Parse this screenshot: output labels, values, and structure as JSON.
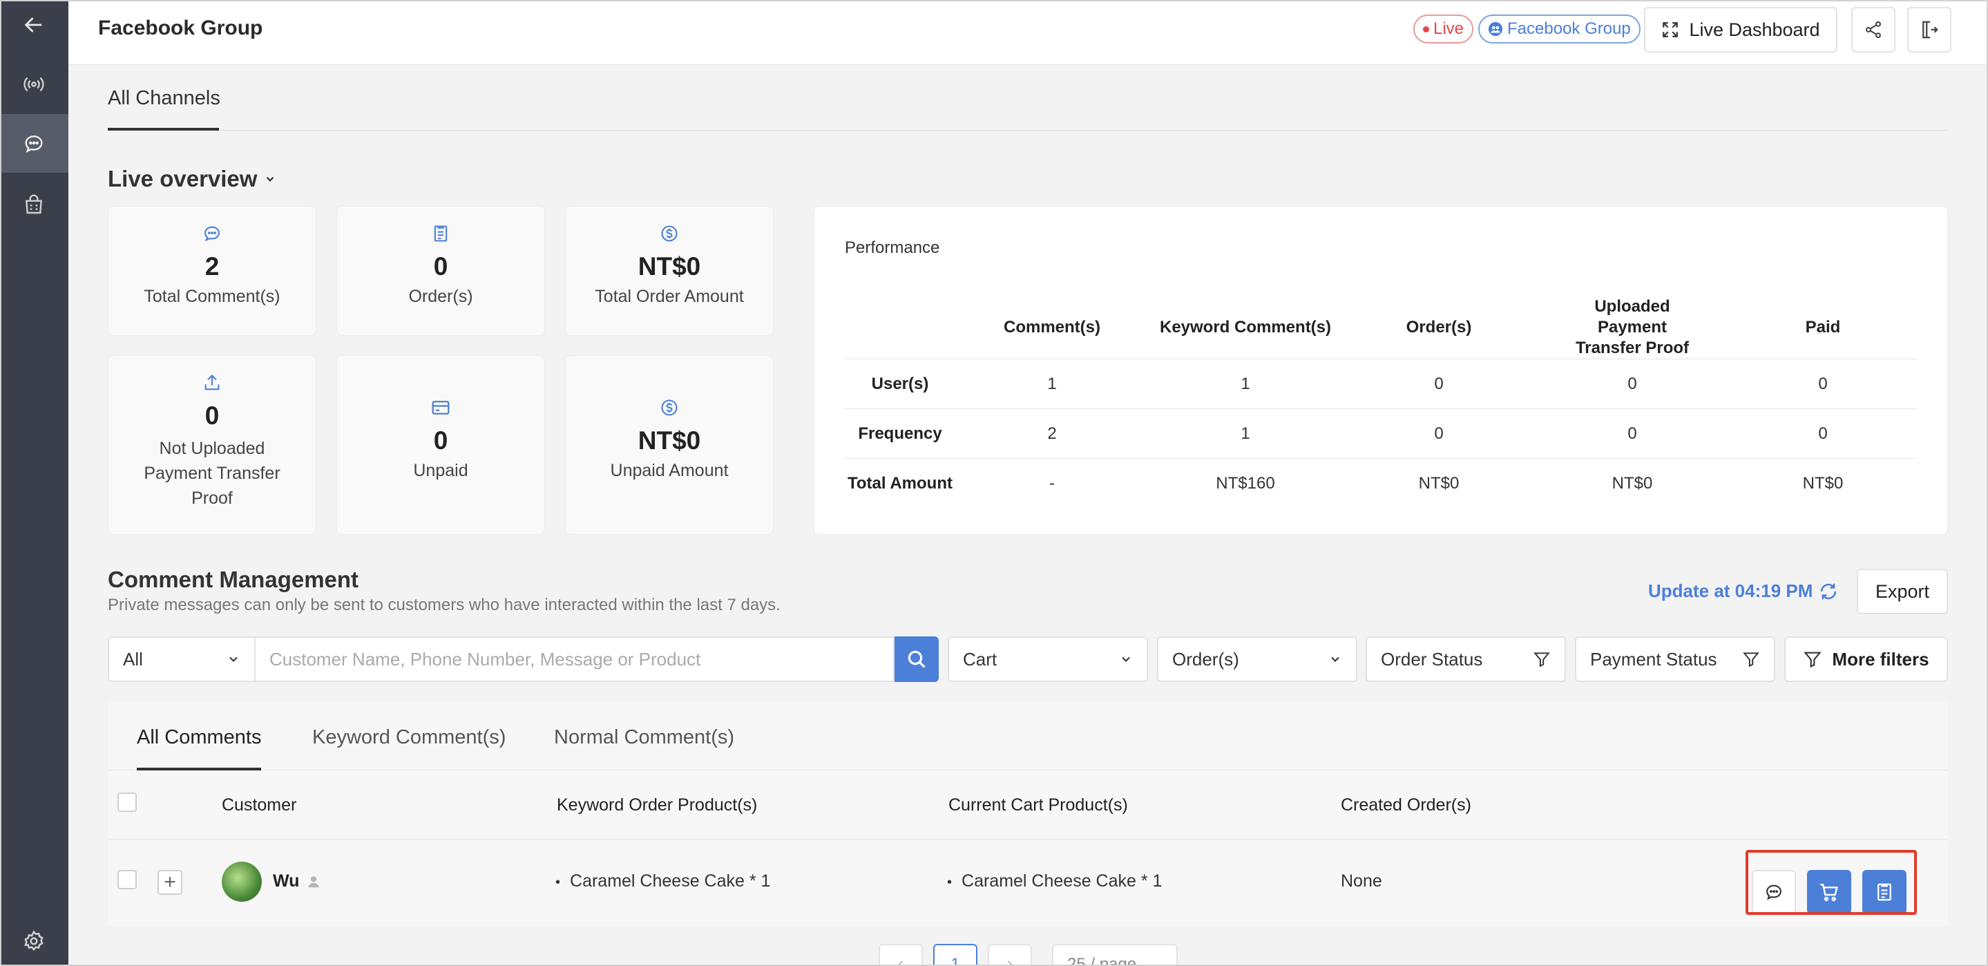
{
  "header": {
    "title": "Facebook Group",
    "live_label": "Live",
    "group_label": "Facebook Group",
    "dashboard_label": "Live Dashboard"
  },
  "tabs": {
    "all_channels": "All Channels"
  },
  "overview": {
    "title": "Live overview",
    "cards": [
      {
        "icon": "chat-icon",
        "value": "2",
        "label": "Total Comment(s)"
      },
      {
        "icon": "order-icon",
        "value": "0",
        "label": "Order(s)"
      },
      {
        "icon": "dollar-icon",
        "value": "NT$0",
        "label": "Total Order Amount"
      },
      {
        "icon": "upload-icon",
        "value": "0",
        "label": "Not Uploaded Payment Transfer Proof"
      },
      {
        "icon": "card-icon",
        "value": "0",
        "label": "Unpaid"
      },
      {
        "icon": "dollar-icon",
        "value": "NT$0",
        "label": "Unpaid Amount"
      }
    ]
  },
  "performance": {
    "title": "Performance",
    "columns": [
      "Comment(s)",
      "Keyword Comment(s)",
      "Order(s)",
      "Uploaded Payment Transfer Proof",
      "Paid"
    ],
    "rows": [
      {
        "label": "User(s)",
        "cells": [
          "1",
          "1",
          "0",
          "0",
          "0"
        ]
      },
      {
        "label": "Frequency",
        "cells": [
          "2",
          "1",
          "0",
          "0",
          "0"
        ]
      },
      {
        "label": "Total Amount",
        "cells": [
          "-",
          "NT$160",
          "NT$0",
          "NT$0",
          "NT$0"
        ]
      }
    ]
  },
  "comments": {
    "title": "Comment Management",
    "subtitle": "Private messages can only be sent to customers who have interacted within the last 7 days.",
    "update_label": "Update at 04:19 PM",
    "export_label": "Export",
    "filters": {
      "scope": "All",
      "search_placeholder": "Customer Name, Phone Number, Message or Product",
      "cart": "Cart",
      "orders": "Order(s)",
      "order_status": "Order Status",
      "payment_status": "Payment Status",
      "more_filters": "More filters"
    },
    "tabs": [
      "All Comments",
      "Keyword Comment(s)",
      "Normal Comment(s)"
    ],
    "columns": [
      "Customer",
      "Keyword Order Product(s)",
      "Current Cart Product(s)",
      "Created Order(s)"
    ],
    "rows": [
      {
        "customer": "Wu",
        "keyword_product": "Caramel Cheese Cake  * 1",
        "cart_product": "Caramel Cheese Cake  * 1",
        "created_orders": "None"
      }
    ],
    "pagination": {
      "current": "1",
      "page_size": "25 / page"
    }
  },
  "colors": {
    "accent": "#4c7fd8",
    "sidebar": "#3b3f4b",
    "live": "#e04a4a",
    "highlight": "#e23a2a"
  }
}
